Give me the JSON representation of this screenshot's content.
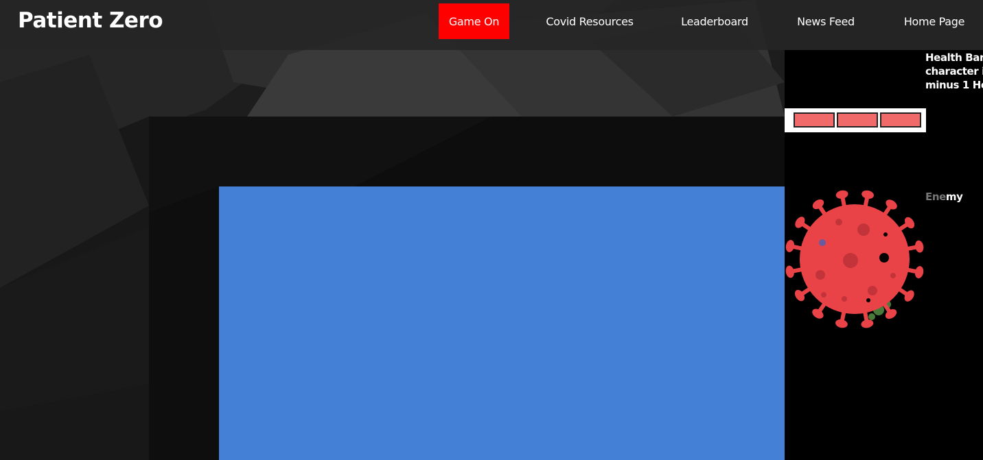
{
  "brand": "Patient Zero",
  "nav": {
    "items": [
      {
        "label": "Game On",
        "active": true
      },
      {
        "label": "Covid Resources",
        "active": false
      },
      {
        "label": "Leaderboard",
        "active": false
      },
      {
        "label": "News Feed",
        "active": false
      },
      {
        "label": "Home Page",
        "active": false
      }
    ]
  },
  "panel": {
    "health_desc_lines": [
      "Health Bar",
      "character i",
      "minus 1 He"
    ],
    "health": {
      "current": 3,
      "max": 3
    },
    "enemy_label_dim": "Ene",
    "enemy_label_rest": "my"
  },
  "game": {
    "enemy_icon": "virus-icon"
  },
  "colors": {
    "accent": "#ff0000",
    "play_area": "#4380d6",
    "virus": "#e94348",
    "health_segment": "#f06a6a"
  }
}
